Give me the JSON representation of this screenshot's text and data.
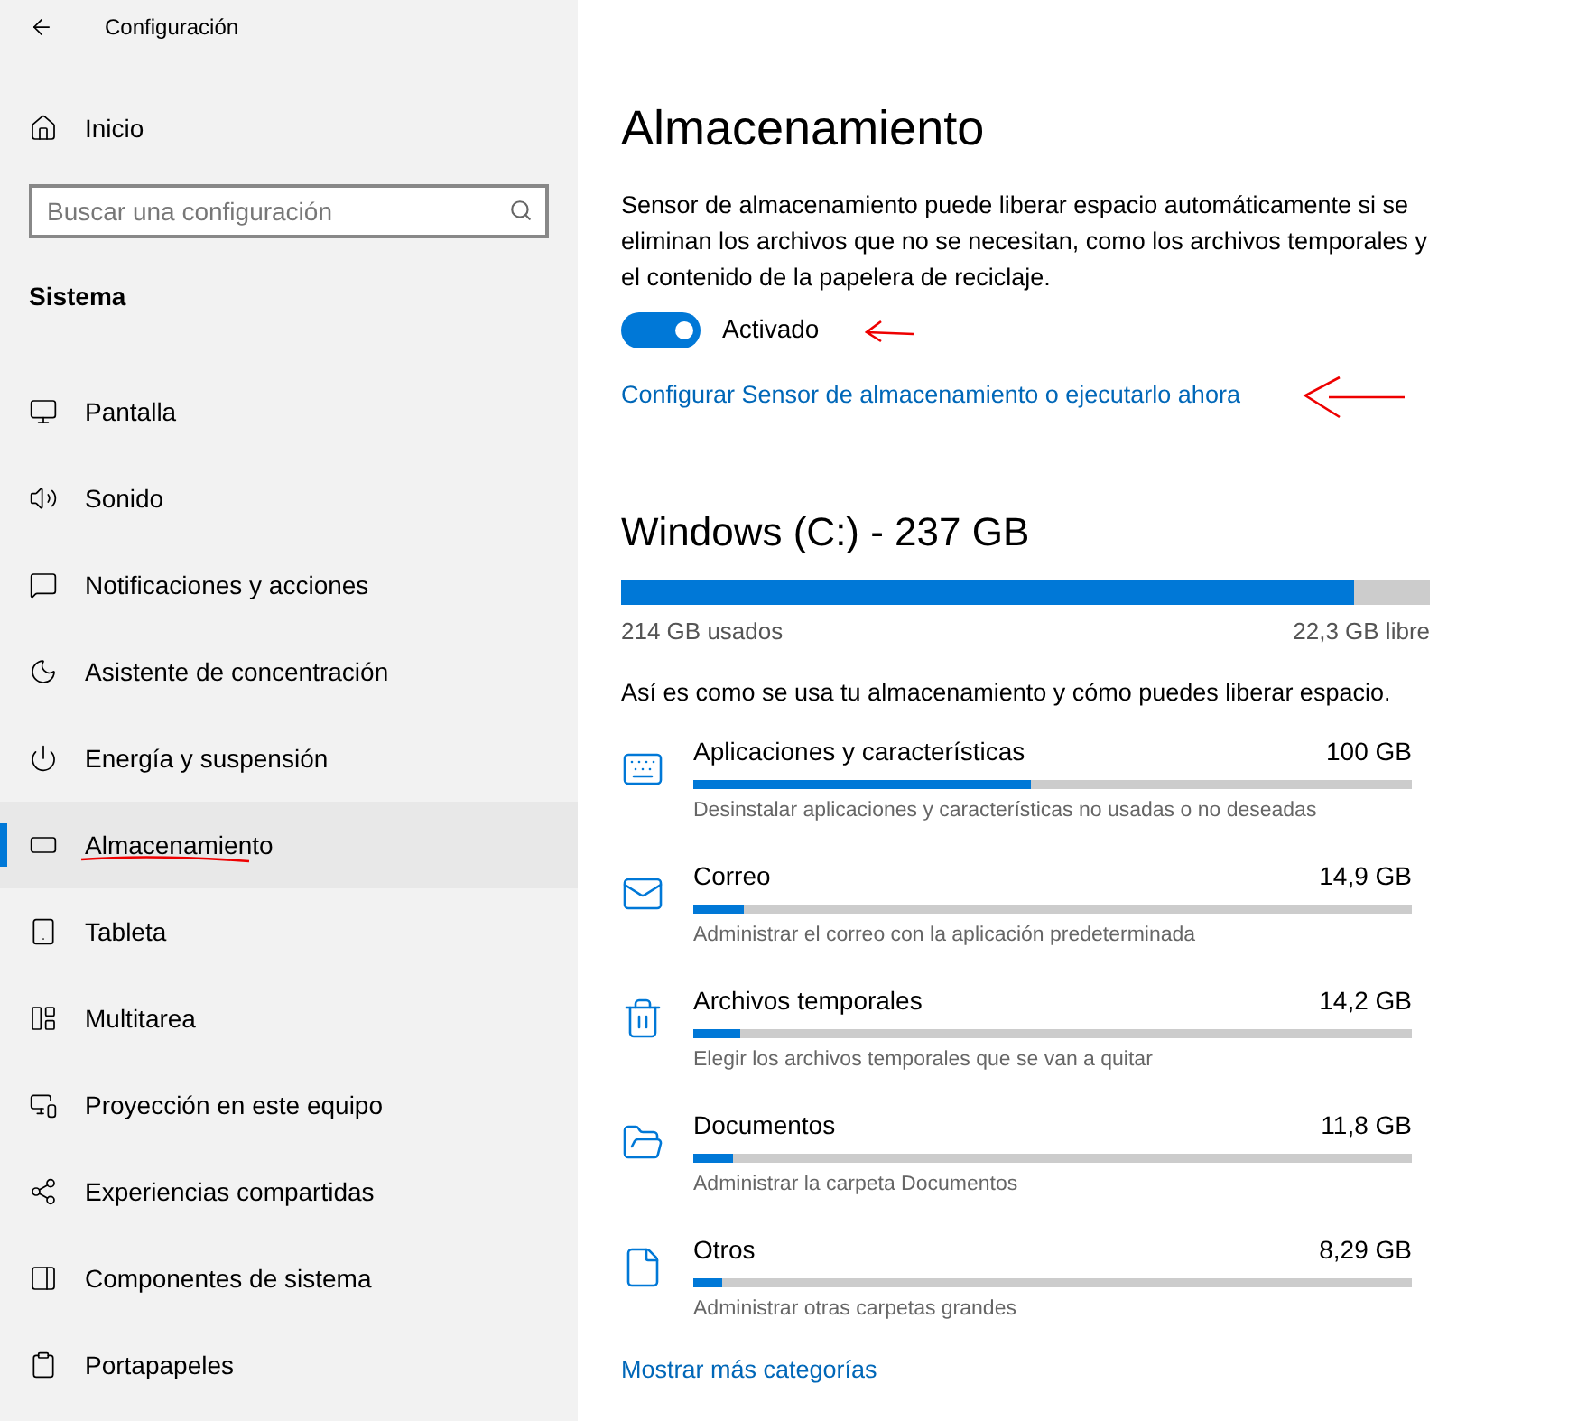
{
  "window": {
    "title": "Configuración"
  },
  "sidebar": {
    "home": "Inicio",
    "search": {
      "placeholder": "Buscar una configuración"
    },
    "section": "Sistema",
    "items": [
      {
        "kind": "display",
        "label": "Pantalla",
        "selected": false
      },
      {
        "kind": "sound",
        "label": "Sonido",
        "selected": false
      },
      {
        "kind": "notifications",
        "label": "Notificaciones y acciones",
        "selected": false
      },
      {
        "kind": "focus",
        "label": "Asistente de concentración",
        "selected": false
      },
      {
        "kind": "power",
        "label": "Energía y suspensión",
        "selected": false
      },
      {
        "kind": "storage",
        "label": "Almacenamiento",
        "selected": true
      },
      {
        "kind": "tablet",
        "label": "Tableta",
        "selected": false
      },
      {
        "kind": "multitask",
        "label": "Multitarea",
        "selected": false
      },
      {
        "kind": "project",
        "label": "Proyección en este equipo",
        "selected": false
      },
      {
        "kind": "shared",
        "label": "Experiencias compartidas",
        "selected": false
      },
      {
        "kind": "components",
        "label": "Componentes de sistema",
        "selected": false
      },
      {
        "kind": "clipboard",
        "label": "Portapapeles",
        "selected": false
      }
    ]
  },
  "main": {
    "title": "Almacenamiento",
    "description": "Sensor de almacenamiento puede liberar espacio automáticamente si se eliminan los archivos que no se necesitan, como los archivos temporales y el contenido de la papelera de reciclaje.",
    "toggle": {
      "on": true,
      "label": "Activado"
    },
    "configure_link": "Configurar Sensor de almacenamiento o ejecutarlo ahora",
    "drive": {
      "title": "Windows (C:) - 237 GB",
      "level": 0.906,
      "used": "214 GB usados",
      "free": "22,3 GB libre"
    },
    "usage_intro": "Así es como se usa tu almacenamiento y cómo puedes liberar espacio.",
    "categories": [
      {
        "kind": "apps",
        "name": "Aplicaciones y características",
        "size": "100 GB",
        "level": 0.47,
        "description": "Desinstalar aplicaciones y características no usadas o no deseadas"
      },
      {
        "kind": "mail",
        "name": "Correo",
        "size": "14,9 GB",
        "level": 0.07,
        "description": "Administrar el correo con la aplicación predeterminada"
      },
      {
        "kind": "temp",
        "name": "Archivos temporales",
        "size": "14,2 GB",
        "level": 0.065,
        "description": "Elegir los archivos temporales que se van a quitar"
      },
      {
        "kind": "documents",
        "name": "Documentos",
        "size": "11,8 GB",
        "level": 0.055,
        "description": "Administrar la carpeta Documentos"
      },
      {
        "kind": "other",
        "name": "Otros",
        "size": "8,29 GB",
        "level": 0.04,
        "description": "Administrar otras carpetas grandes"
      }
    ],
    "more_link": "Mostrar más categorías"
  }
}
